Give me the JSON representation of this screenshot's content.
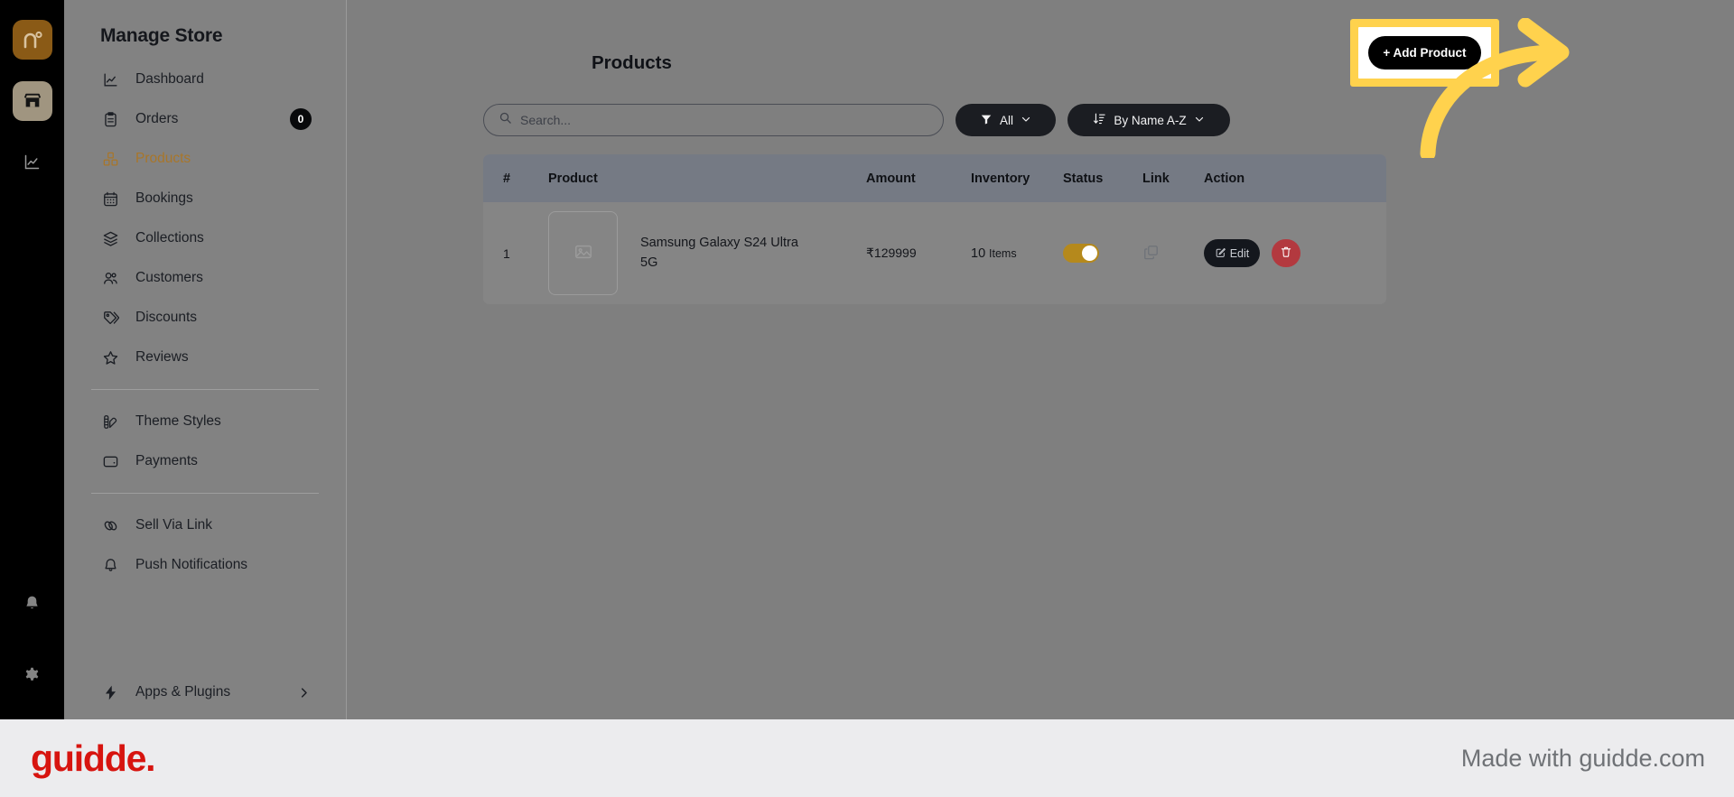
{
  "rail": {
    "logo_label": "n°",
    "items": [
      {
        "name": "store-icon",
        "label": "Store"
      },
      {
        "name": "analytics-icon",
        "label": "Analytics"
      }
    ],
    "bottom_items": [
      {
        "name": "bell-icon",
        "label": "Notifications"
      },
      {
        "name": "gear-icon",
        "label": "Settings"
      }
    ]
  },
  "sidebar": {
    "title": "Manage Store",
    "items": [
      {
        "label": "Dashboard",
        "icon": "chart-line-icon",
        "active": false,
        "badge": null
      },
      {
        "label": "Orders",
        "icon": "clipboard-icon",
        "active": false,
        "badge": "0"
      },
      {
        "label": "Products",
        "icon": "boxes-icon",
        "active": true,
        "badge": null
      },
      {
        "label": "Bookings",
        "icon": "calendar-icon",
        "active": false,
        "badge": null
      },
      {
        "label": "Collections",
        "icon": "layers-icon",
        "active": false,
        "badge": null
      },
      {
        "label": "Customers",
        "icon": "users-icon",
        "active": false,
        "badge": null
      },
      {
        "label": "Discounts",
        "icon": "tag-icon",
        "active": false,
        "badge": null
      },
      {
        "label": "Reviews",
        "icon": "star-icon",
        "active": false,
        "badge": null
      }
    ],
    "group2": [
      {
        "label": "Theme Styles",
        "icon": "palette-icon"
      },
      {
        "label": "Payments",
        "icon": "wallet-icon"
      }
    ],
    "group3": [
      {
        "label": "Sell Via Link",
        "icon": "link-icon"
      },
      {
        "label": "Push Notifications",
        "icon": "bell-icon"
      }
    ],
    "footer_item": {
      "label": "Apps & Plugins",
      "icon": "bolt-icon",
      "chevron": "chevron-right-icon"
    }
  },
  "main": {
    "page_title": "Products",
    "add_product_label": "+ Add Product",
    "search": {
      "placeholder": "Search...",
      "value": ""
    },
    "filter": {
      "label": "All",
      "icon": "funnel-icon",
      "chevron": "chevron-down-icon"
    },
    "sort": {
      "label": "By Name A-Z",
      "icon": "sort-desc-icon",
      "chevron": "chevron-down-icon"
    },
    "table": {
      "columns": [
        "#",
        "Product",
        "Amount",
        "Inventory",
        "Status",
        "Link",
        "Action"
      ],
      "rows": [
        {
          "index": "1",
          "product_name": "Samsung Galaxy S24 Ultra 5G",
          "amount": "₹129999",
          "inventory_count": "10",
          "inventory_unit": "Items",
          "status_on": true,
          "link_icon": "copy-icon",
          "edit_label": "Edit",
          "delete_icon": "trash-icon"
        }
      ]
    }
  },
  "footer": {
    "logo_text": "guidde.",
    "made_with": "Made with guidde.com"
  },
  "colors": {
    "accent_gold": "#a8762a",
    "toggle_on": "#b5891c",
    "highlight_yellow": "#ffd24d",
    "delete_red": "#b3393f",
    "guidde_red": "#d7140f"
  }
}
